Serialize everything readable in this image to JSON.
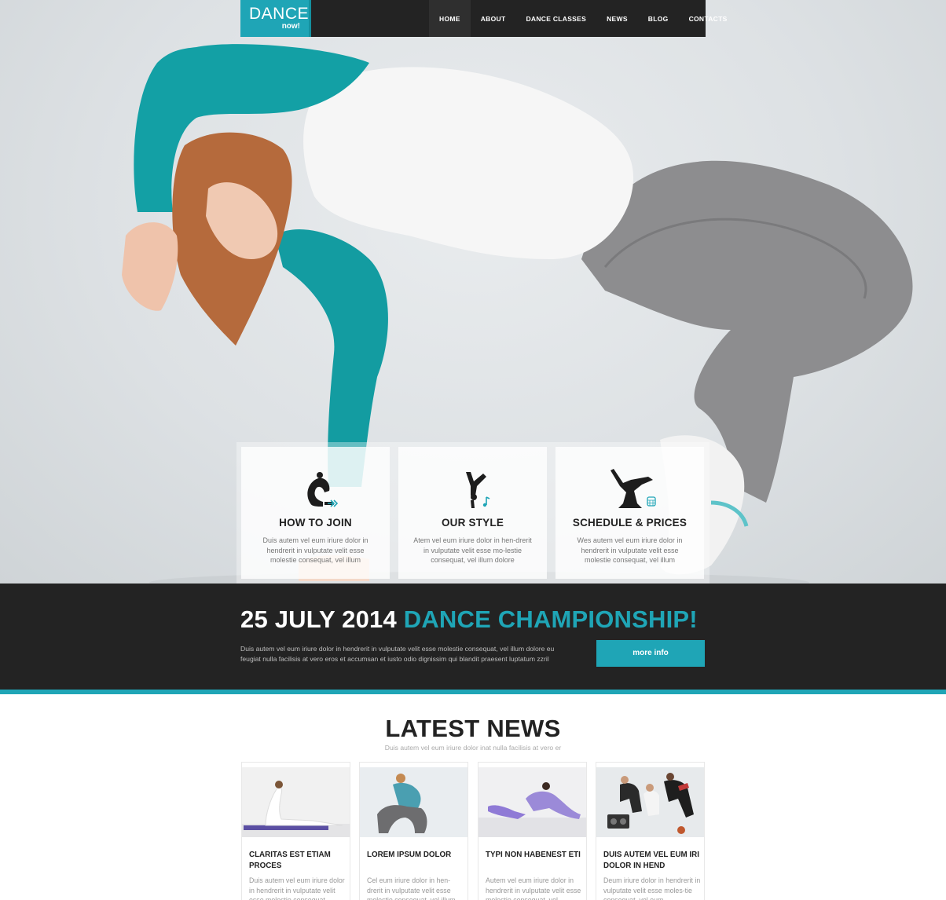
{
  "brand": {
    "logo_main": "DANCE",
    "logo_sub": "now!",
    "accent_color": "#1fa5b6",
    "dark_color": "#232323"
  },
  "nav": {
    "items": [
      {
        "label": "HOME",
        "active": true
      },
      {
        "label": "ABOUT",
        "active": false
      },
      {
        "label": "DANCE CLASSES",
        "active": false
      },
      {
        "label": "NEWS",
        "active": false
      },
      {
        "label": "BLOG",
        "active": false
      },
      {
        "label": "CONTACTS",
        "active": false
      }
    ]
  },
  "features": [
    {
      "icon": "dancer-join-icon",
      "title": "HOW TO JOIN",
      "text": "Duis autem vel eum iriure dolor in hendrerit in vulputate velit esse molestie consequat, vel illum"
    },
    {
      "icon": "dancer-style-icon",
      "title": "OUR STYLE",
      "text": "Atem vel eum iriure dolor in hen-drerit in vulputate velit esse mo-lestie consequat, vel illum dolore"
    },
    {
      "icon": "dancer-schedule-icon",
      "title": "SCHEDULE & PRICES",
      "text": "Wes autem vel eum iriure dolor in hendrerit in vulputate velit esse molestie consequat, vel illum"
    }
  ],
  "banner": {
    "date": "25 JULY 2014",
    "event": "DANCE CHAMPIONSHIP!",
    "text": "Duis autem vel eum iriure dolor in hendrerit in vulputate velit esse molestie consequat, vel illum dolore eu feugiat nulla facilisis at vero eros et accumsan et iusto odio dignissim qui blandit praesent luptatum zzril",
    "button": "more info"
  },
  "news": {
    "title": "LATEST NEWS",
    "subtitle": "Duis autem vel eum iriure dolor inat nulla facilisis at vero er",
    "items": [
      {
        "title": "CLARITAS EST ETIAM PROCES",
        "text": "Duis autem vel eum iriure dolor in hendrerit in vulputate velit esse molestie consequat"
      },
      {
        "title": "LOREM IPSUM DOLOR",
        "text": "Cel eum iriure dolor in hen-drerit in vulputate velit esse molestie consequat, vel illum"
      },
      {
        "title": "TYPI NON HABENEST ETI",
        "text": "Autem vel eum iriure dolor in hendrerit in vulputate velit esse molestie consequat, vel"
      },
      {
        "title": "DUIS AUTEM VEL EUM IRI DOLOR IN HEND",
        "text": "Deum iriure dolor in hendrerit in vulputate velit esse moles-tie consequat, vel eum"
      }
    ]
  }
}
